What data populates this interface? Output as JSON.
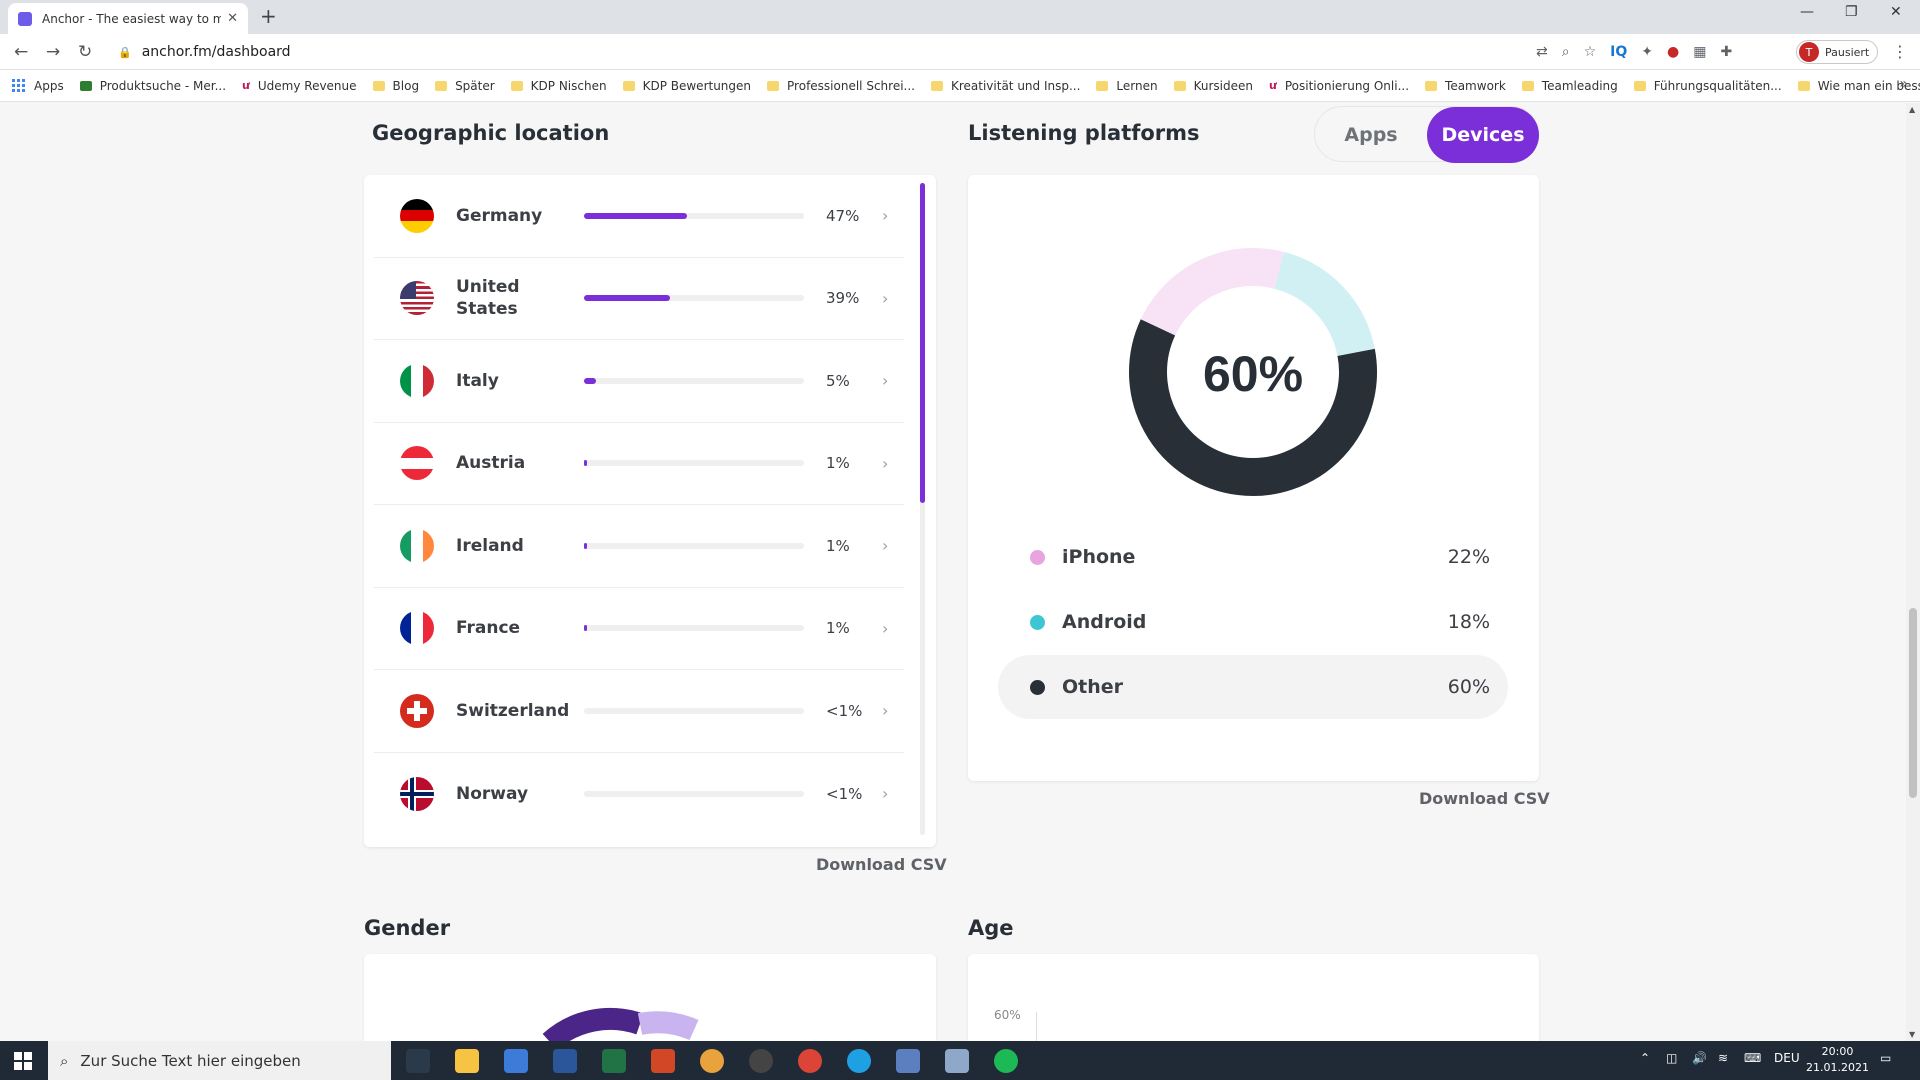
{
  "browser": {
    "tab_title": "Anchor - The easiest way to mak",
    "url": "anchor.fm/dashboard",
    "profile_label": "Pausiert",
    "profile_initial": "T",
    "bookmarks": [
      "Apps",
      "Produktsuche - Mer...",
      "Udemy Revenue",
      "Blog",
      "Später",
      "KDP Nischen",
      "KDP Bewertungen",
      "Professionell Schrei...",
      "Kreativität und Insp...",
      "Lernen",
      "Kursideen",
      "Positionierung Onli...",
      "Teamwork",
      "Teamleading",
      "Führungsqualitäten...",
      "Wie man ein besser..."
    ]
  },
  "geo": {
    "title": "Geographic location",
    "download_label": "Download CSV",
    "countries": [
      {
        "name": "Germany",
        "pct_label": "47%",
        "fill": 47
      },
      {
        "name": "United States",
        "pct_label": "39%",
        "fill": 39
      },
      {
        "name": "Italy",
        "pct_label": "5%",
        "fill": 5
      },
      {
        "name": "Austria",
        "pct_label": "1%",
        "fill": 1
      },
      {
        "name": "Ireland",
        "pct_label": "1%",
        "fill": 1
      },
      {
        "name": "France",
        "pct_label": "1%",
        "fill": 1
      },
      {
        "name": "Switzerland",
        "pct_label": "<1%",
        "fill": 0
      },
      {
        "name": "Norway",
        "pct_label": "<1%",
        "fill": 0
      }
    ]
  },
  "platforms": {
    "title": "Listening platforms",
    "toggle_apps": "Apps",
    "toggle_devices": "Devices",
    "download_label": "Download CSV",
    "center_label": "60%",
    "legend": [
      {
        "name": "iPhone",
        "value": "22%",
        "color": "#e7a4e0"
      },
      {
        "name": "Android",
        "value": "18%",
        "color": "#3ec6d2"
      },
      {
        "name": "Other",
        "value": "60%",
        "color": "#292f36"
      }
    ]
  },
  "chart_data": {
    "type": "pie",
    "categories": [
      "iPhone",
      "Android",
      "Other"
    ],
    "values": [
      22,
      18,
      60
    ],
    "title": "",
    "colors": [
      "#f7e3f5",
      "#d1f0f3",
      "#292f36"
    ]
  },
  "gender": {
    "title": "Gender"
  },
  "age": {
    "title": "Age",
    "first_tick": "60%"
  },
  "taskbar": {
    "search_placeholder": "Zur Suche Text hier eingeben",
    "lang": "DEU",
    "time": "20:00",
    "date": "21.01.2021"
  }
}
